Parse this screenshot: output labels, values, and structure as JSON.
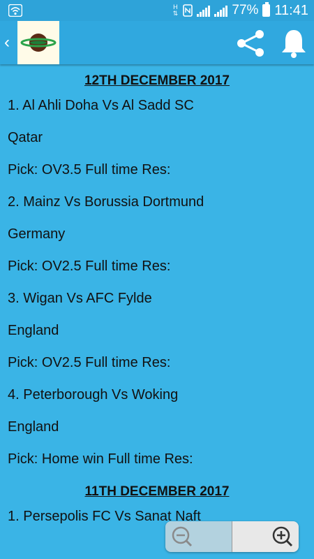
{
  "status_bar": {
    "network_label": "H",
    "battery_percent": "77%",
    "time": "11:41"
  },
  "app_bar": {
    "back_icon": "chevron-left-icon",
    "logo_icon": "planet-logo-icon",
    "share_icon": "share-icon",
    "notification_icon": "bell-icon"
  },
  "content": {
    "sections": [
      {
        "date": "12TH DECEMBER 2017",
        "lines": [
          "1. Al Ahli Doha Vs Al Sadd SC",
          "Qatar",
          "Pick: OV3.5 Full time Res:",
          "2. Mainz Vs Borussia Dortmund",
          "Germany",
          "Pick: OV2.5 Full time Res:",
          "3. Wigan Vs AFC Fylde",
          "England",
          "Pick: OV2.5 Full time Res:",
          "4. Peterborough Vs Woking",
          "England",
          "Pick: Home win Full time Res:"
        ]
      },
      {
        "date": "11TH DECEMBER 2017",
        "lines": [
          "1. Persepolis FC Vs Sanat Naft"
        ]
      }
    ]
  },
  "zoom_controls": {
    "zoom_out_icon": "zoom-out-icon",
    "zoom_in_icon": "zoom-in-icon"
  }
}
